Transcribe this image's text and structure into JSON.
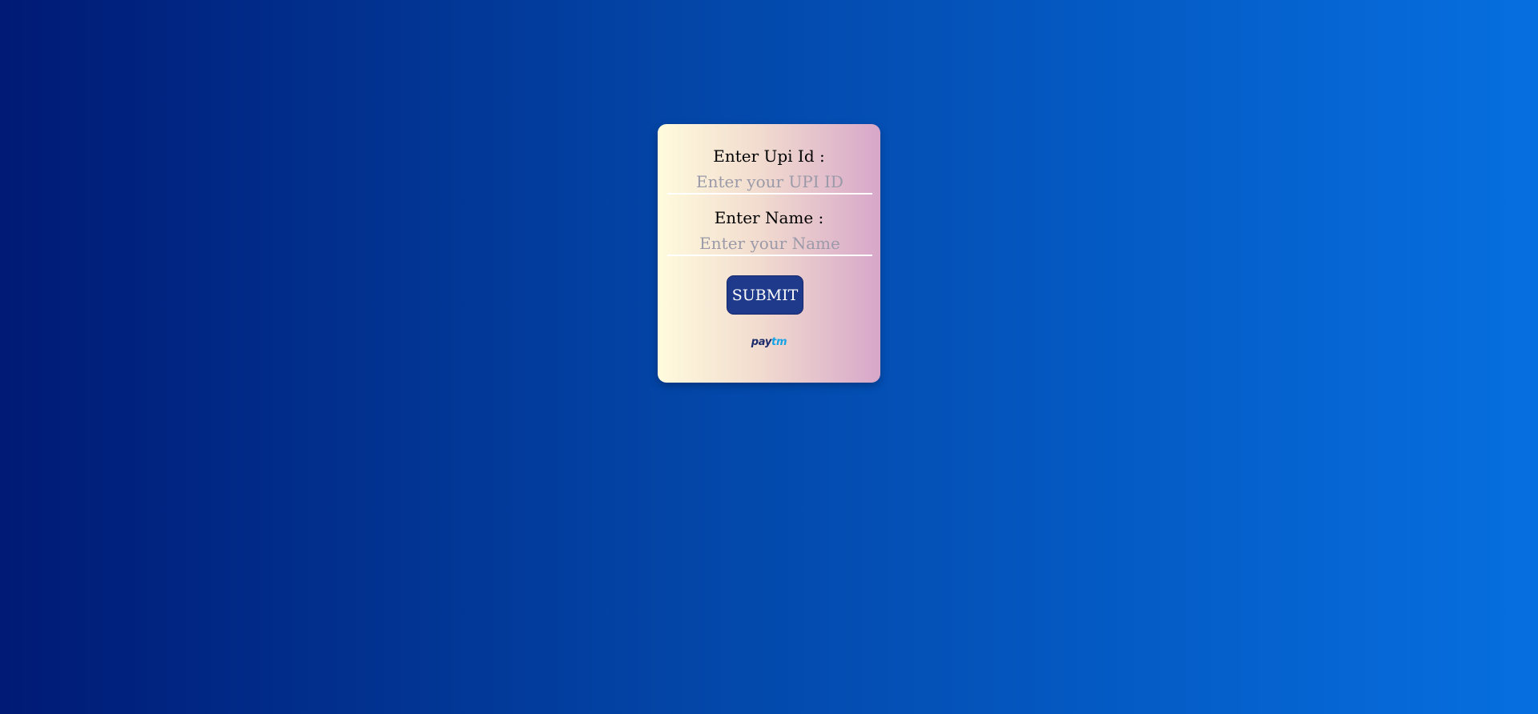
{
  "form": {
    "upi_label": "Enter Upi Id :",
    "upi_placeholder": "Enter your UPI ID",
    "upi_value": "",
    "name_label": "Enter Name :",
    "name_placeholder": "Enter your Name",
    "name_value": "",
    "submit_label": "SUBMIT"
  },
  "logo": {
    "part1": "pay",
    "part2": "tm",
    "colors": {
      "part1": "#1c2c6b",
      "part2": "#14a3e6"
    }
  },
  "colors": {
    "background_start": "#001a75",
    "background_end": "#066fe0",
    "card_start": "#fffbdd",
    "card_end": "#d7a7c9",
    "button": "#1f3a8a"
  }
}
